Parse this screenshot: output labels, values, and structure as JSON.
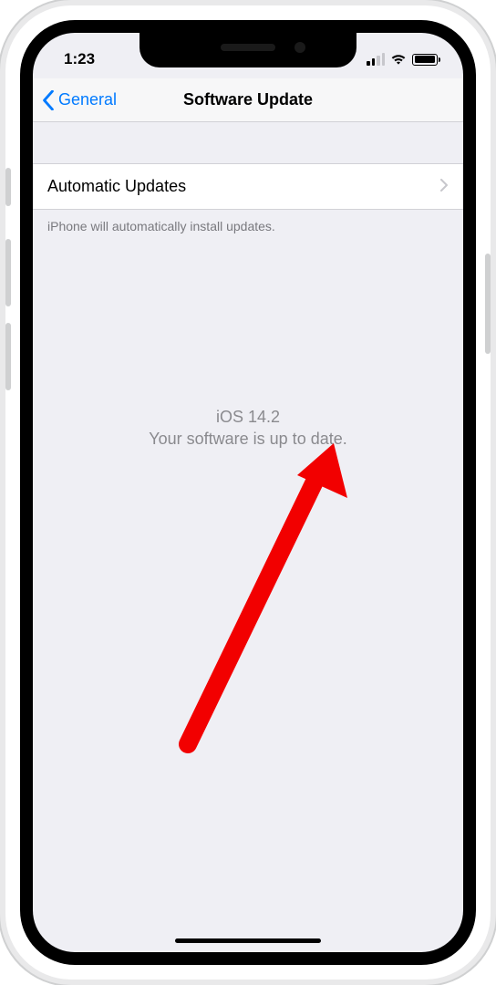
{
  "status": {
    "time": "1:23"
  },
  "nav": {
    "back_label": "General",
    "title": "Software Update"
  },
  "rows": {
    "automatic_updates_label": "Automatic Updates"
  },
  "footer": {
    "text": "iPhone will automatically install updates."
  },
  "center": {
    "version": "iOS 14.2",
    "message": "Your software is up to date."
  }
}
